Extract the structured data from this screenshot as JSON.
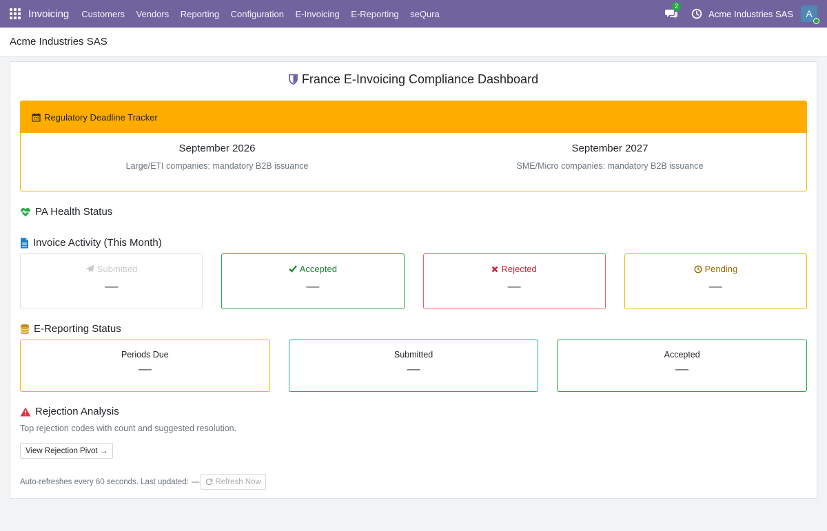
{
  "navbar": {
    "brand": "Invoicing",
    "menu": [
      "Customers",
      "Vendors",
      "Reporting",
      "Configuration",
      "E-Invoicing",
      "E-Reporting",
      "seQura"
    ],
    "chat_count": "2",
    "company": "Acme Industries SAS",
    "avatar_letter": "A",
    "color": "#71639e"
  },
  "breadcrumb": "Acme Industries SAS",
  "dashboard": {
    "title": "France E-Invoicing Compliance Dashboard",
    "deadline": {
      "header": "Regulatory Deadline Tracker",
      "items": [
        {
          "date": "September 2026",
          "desc": "Large/ETI companies: mandatory B2B issuance"
        },
        {
          "date": "September 2027",
          "desc": "SME/Micro companies: mandatory B2B issuance"
        }
      ],
      "color": "#ffac00"
    },
    "pa_health": {
      "title": "PA Health Status"
    },
    "invoice_activity": {
      "title": "Invoice Activity (This Month)",
      "cards": [
        {
          "label": "Submitted",
          "value": "—",
          "color": "#c8ccd0"
        },
        {
          "label": "Accepted",
          "value": "—",
          "color": "#28a745"
        },
        {
          "label": "Rejected",
          "value": "—",
          "color": "#dc3545"
        },
        {
          "label": "Pending",
          "value": "—",
          "color": "#f5a700"
        }
      ]
    },
    "ereporting": {
      "title": "E-Reporting Status",
      "cards": [
        {
          "label": "Periods Due",
          "value": "—",
          "color": "#f5a700"
        },
        {
          "label": "Submitted",
          "value": "—",
          "color": "#17a2b8"
        },
        {
          "label": "Accepted",
          "value": "—",
          "color": "#28a745"
        }
      ]
    },
    "rejection": {
      "title": "Rejection Analysis",
      "desc": "Top rejection codes with count and suggested resolution.",
      "button": "View Rejection Pivot →"
    },
    "footer": {
      "text": "Auto-refreshes every 60 seconds. Last updated:",
      "last_updated": "—",
      "refresh_button": "Refresh Now"
    }
  }
}
